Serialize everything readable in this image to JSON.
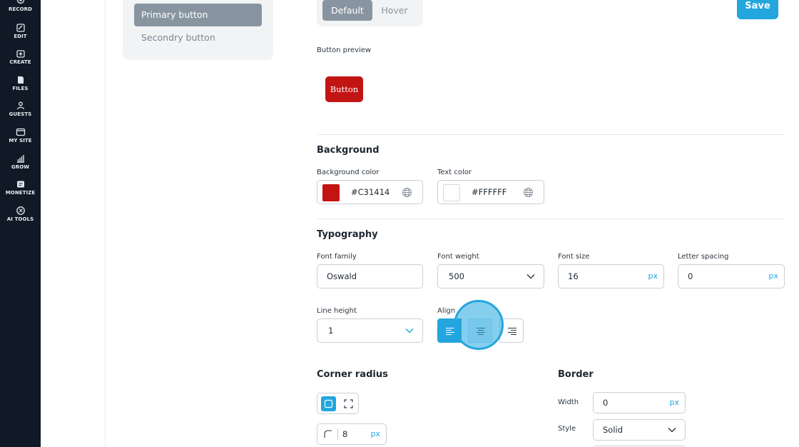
{
  "nav": {
    "items": [
      {
        "label": "RECORD",
        "icon": "record-icon"
      },
      {
        "label": "EDIT",
        "icon": "edit-icon"
      },
      {
        "label": "CREATE",
        "icon": "create-icon"
      },
      {
        "label": "FILES",
        "icon": "files-icon"
      },
      {
        "label": "GUESTS",
        "icon": "guests-icon"
      },
      {
        "label": "MY SITE",
        "icon": "my-site-icon"
      },
      {
        "label": "GROW",
        "icon": "grow-icon"
      },
      {
        "label": "MONETIZE",
        "icon": "monetize-icon"
      },
      {
        "label": "AI TOOLS",
        "icon": "ai-tools-icon"
      }
    ]
  },
  "button_types": {
    "primary": "Primary button",
    "secondary": "Secondry button"
  },
  "state_toggle": {
    "default": "Default",
    "hover": "Hover"
  },
  "save_label": "Save",
  "preview": {
    "label": "Button preview",
    "button_text": "Button"
  },
  "background": {
    "title": "Background",
    "bg_color_label": "Background color",
    "bg_color_value": "#C31414",
    "text_color_label": "Text color",
    "text_color_value": "#FFFFFF"
  },
  "typography": {
    "title": "Typography",
    "font_family_label": "Font family",
    "font_family_value": "Oswald",
    "font_weight_label": "Font weight",
    "font_weight_value": "500",
    "font_size_label": "Font size",
    "font_size_value": "16",
    "letter_spacing_label": "Letter spacing",
    "letter_spacing_value": "0",
    "line_height_label": "Line height",
    "line_height_value": "1",
    "align_label": "Align",
    "unit": "px"
  },
  "corner_radius": {
    "title": "Corner radius",
    "value": "8",
    "unit": "px"
  },
  "border": {
    "title": "Border",
    "width_label": "Width",
    "width_value": "0",
    "style_label": "Style",
    "style_value": "Solid",
    "unit": "px"
  },
  "colors": {
    "accent": "#23a6de",
    "nav_bg": "#0f1a26",
    "button_bg": "#C31414"
  }
}
